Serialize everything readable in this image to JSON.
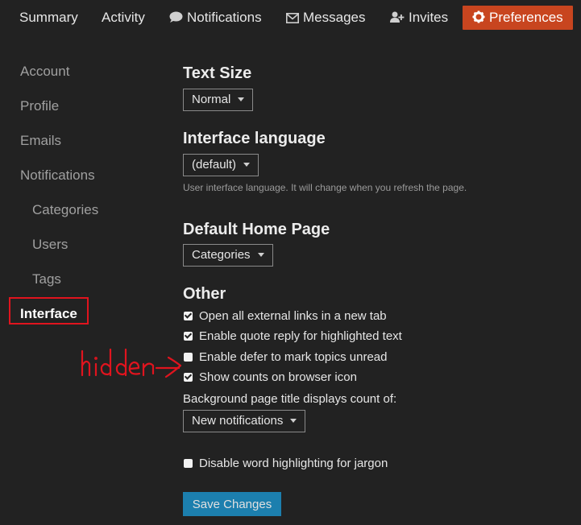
{
  "nav": {
    "items": [
      {
        "label": "Summary",
        "icon": ""
      },
      {
        "label": "Activity",
        "icon": ""
      },
      {
        "label": "Notifications",
        "icon": "comment-icon"
      },
      {
        "label": "Messages",
        "icon": "envelope-icon"
      },
      {
        "label": "Invites",
        "icon": "user-plus-icon"
      },
      {
        "label": "Preferences",
        "icon": "gear-icon",
        "active": true
      }
    ],
    "accent": "#c8451f"
  },
  "sidebar": {
    "items": [
      {
        "label": "Account"
      },
      {
        "label": "Profile"
      },
      {
        "label": "Emails"
      },
      {
        "label": "Notifications"
      },
      {
        "label": "Categories"
      },
      {
        "label": "Users"
      },
      {
        "label": "Tags"
      },
      {
        "label": "Interface",
        "active": true
      }
    ]
  },
  "main": {
    "text_size": {
      "heading": "Text Size",
      "value": "Normal"
    },
    "language": {
      "heading": "Interface language",
      "value": "(default)",
      "hint": "User interface language. It will change when you refresh the page."
    },
    "home_page": {
      "heading": "Default Home Page",
      "value": "Categories"
    },
    "other": {
      "heading": "Other",
      "checkboxes": [
        {
          "label": "Open all external links in a new tab",
          "checked": true
        },
        {
          "label": "Enable quote reply for highlighted text",
          "checked": true
        },
        {
          "label": "Enable defer to mark topics unread",
          "checked": false
        },
        {
          "label": "Show counts on browser icon",
          "checked": true
        }
      ],
      "title_count_label": "Background page title displays count of:",
      "title_count_value": "New notifications",
      "jargon": {
        "label": "Disable word highlighting for jargon",
        "checked": false
      }
    },
    "save_label": "Save Changes",
    "save_color": "#1c7fae"
  },
  "annotation": {
    "text": "hidden",
    "color": "#e0141e"
  }
}
